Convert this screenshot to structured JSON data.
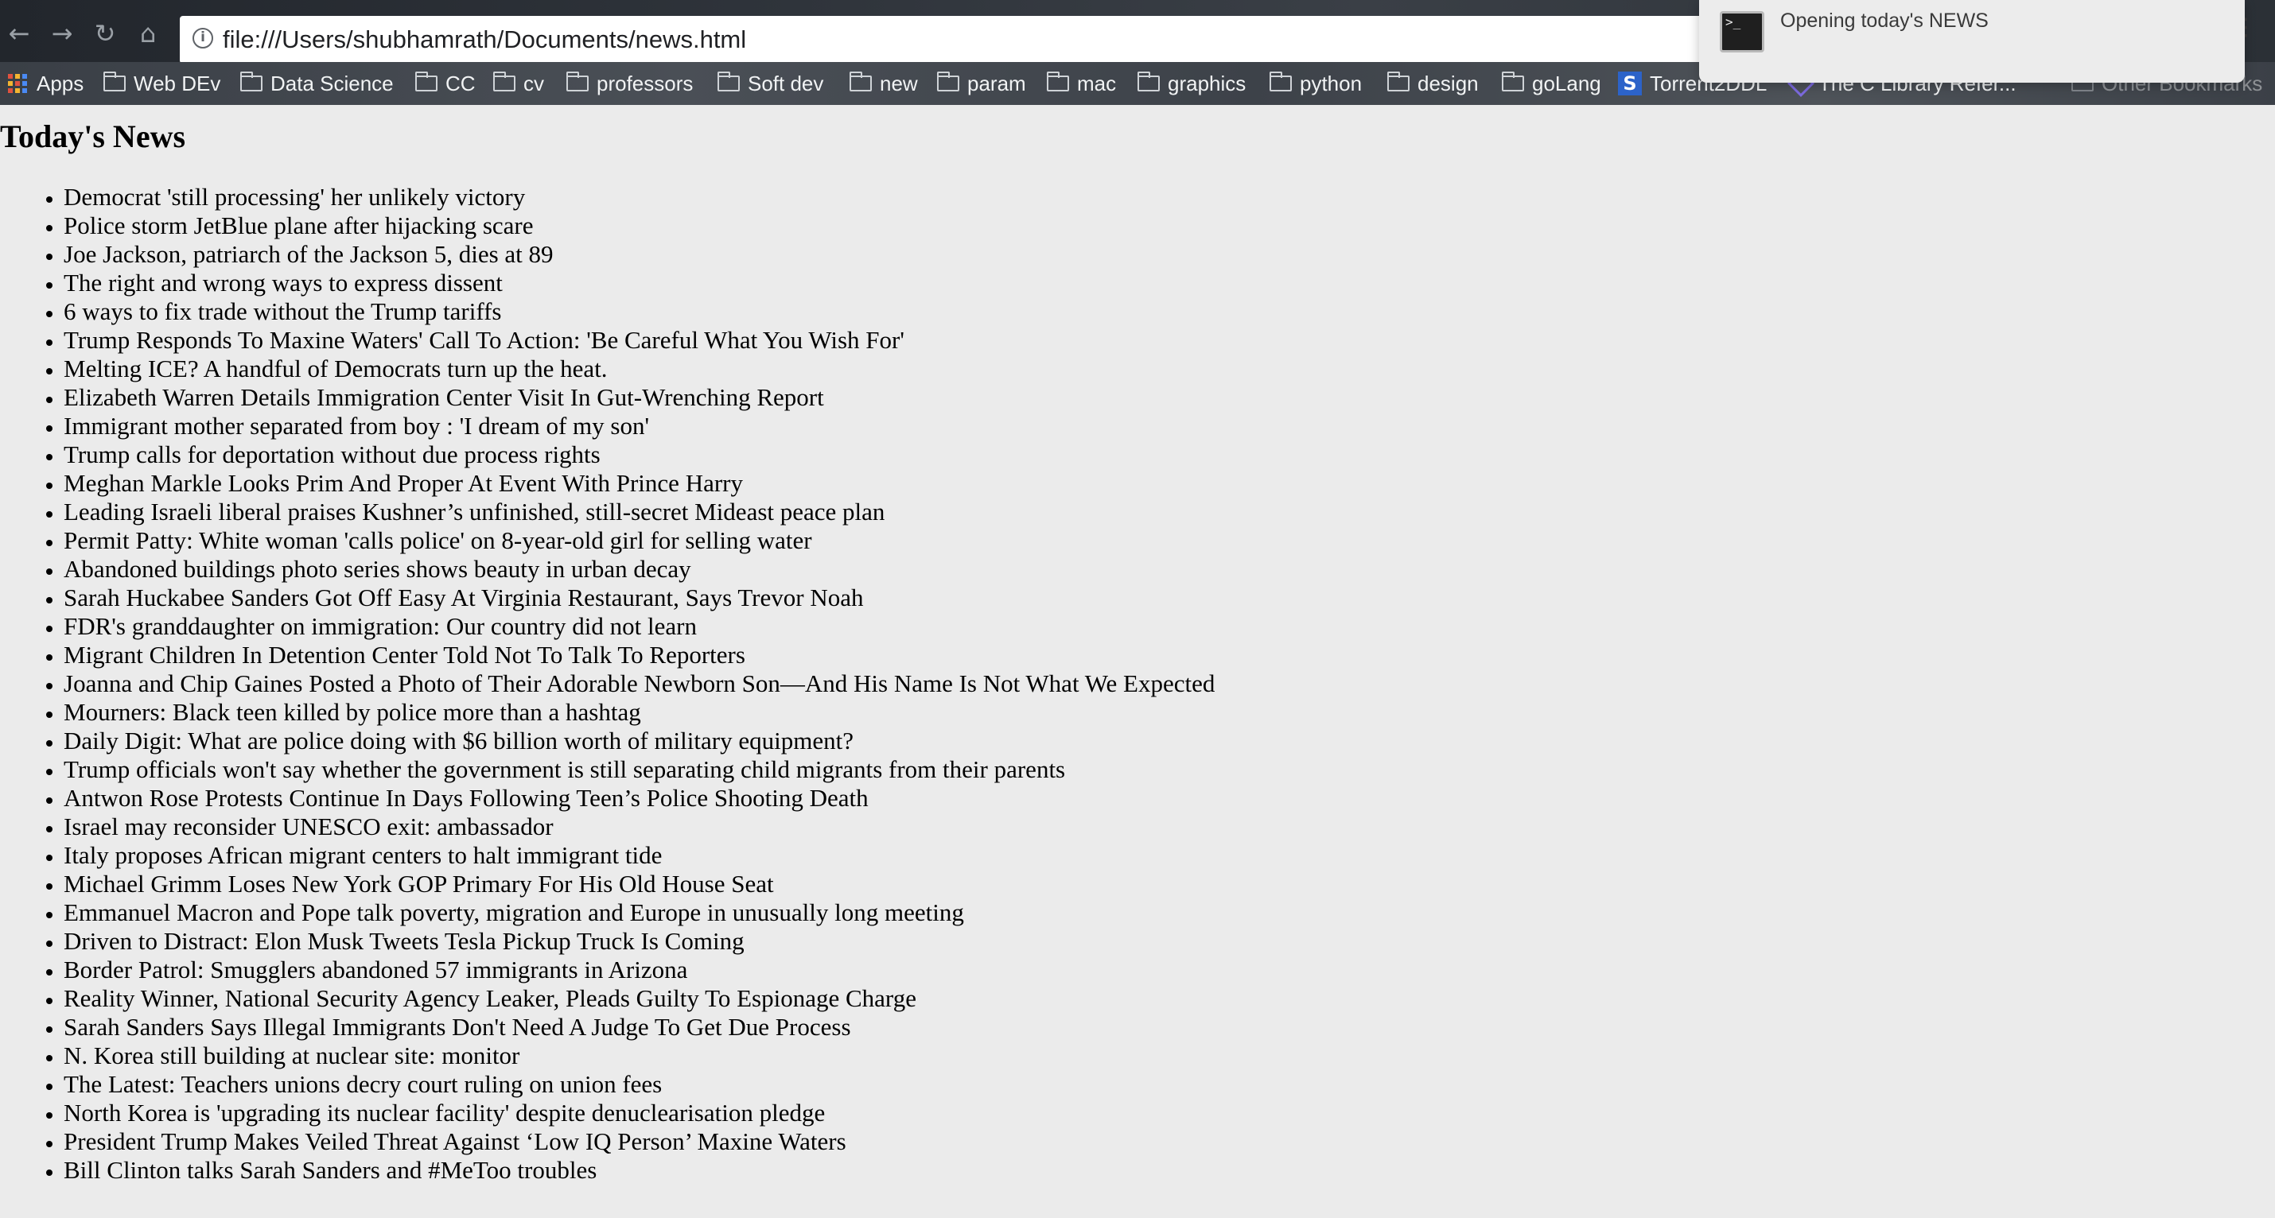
{
  "browser": {
    "url": "file:///Users/shubhamrath/Documents/news.html",
    "nav": {
      "back_glyph": "←",
      "forward_glyph": "→",
      "reload_glyph": "↻",
      "home_glyph": "⌂"
    },
    "more_glyph": "⋮"
  },
  "bookmarks": [
    {
      "label": "Apps",
      "icon": "apps-grid-icon"
    },
    {
      "label": "Web DEv",
      "icon": "folder-icon"
    },
    {
      "label": "Data Science",
      "icon": "folder-icon"
    },
    {
      "label": "CC",
      "icon": "folder-icon"
    },
    {
      "label": "cv",
      "icon": "folder-icon"
    },
    {
      "label": "professors",
      "icon": "folder-icon"
    },
    {
      "label": "Soft dev",
      "icon": "folder-icon"
    },
    {
      "label": "new",
      "icon": "folder-icon"
    },
    {
      "label": "param",
      "icon": "folder-icon"
    },
    {
      "label": "mac",
      "icon": "folder-icon"
    },
    {
      "label": "graphics",
      "icon": "folder-icon"
    },
    {
      "label": "python",
      "icon": "folder-icon"
    },
    {
      "label": "design",
      "icon": "folder-icon"
    },
    {
      "label": "goLang",
      "icon": "folder-icon"
    },
    {
      "label": "Torrent2DDL",
      "icon": "s-site-icon"
    },
    {
      "label": "The C Library Refer...",
      "icon": "diamond-site-icon"
    },
    {
      "label": "Other Bookmarks",
      "icon": "folder-icon"
    }
  ],
  "notification": {
    "title": "Opening today's NEWS",
    "icon_glyph": ">_"
  },
  "page": {
    "title": "Today's News",
    "headlines": [
      "Democrat 'still processing' her unlikely victory",
      "Police storm JetBlue plane after hijacking scare",
      "Joe Jackson, patriarch of the Jackson 5, dies at 89",
      "The right and wrong ways to express dissent",
      "6 ways to fix trade without the Trump tariffs",
      "Trump Responds To Maxine Waters' Call To Action: 'Be Careful What You Wish For'",
      "Melting ICE? A handful of Democrats turn up the heat.",
      "Elizabeth Warren Details Immigration Center Visit In Gut-Wrenching Report",
      "Immigrant mother separated from boy : 'I dream of my son'",
      "Trump calls for deportation without due process rights",
      "Meghan Markle Looks Prim And Proper At Event With Prince Harry",
      "Leading Israeli liberal praises Kushner’s unfinished, still-secret Mideast peace plan",
      "Permit Patty: White woman 'calls police' on 8-year-old girl for selling water",
      "Abandoned buildings photo series shows beauty in urban decay",
      "Sarah Huckabee Sanders Got Off Easy At Virginia Restaurant, Says Trevor Noah",
      "FDR's granddaughter on immigration: Our country did not learn",
      "Migrant Children In Detention Center Told Not To Talk To Reporters",
      "Joanna and Chip Gaines Posted a Photo of Their Adorable Newborn Son—And His Name Is Not What We Expected",
      "Mourners: Black teen killed by police more than a hashtag",
      "Daily Digit: What are police doing with $6 billion worth of military equipment?",
      "Trump officials won't say whether the government is still separating child migrants from their parents",
      "Antwon Rose Protests Continue In Days Following Teen’s Police Shooting Death",
      "Israel may reconsider UNESCO exit: ambassador",
      "Italy proposes African migrant centers to halt immigrant tide",
      "Michael Grimm Loses New York GOP Primary For His Old House Seat",
      "Emmanuel Macron and Pope talk poverty, migration and Europe in unusually long meeting",
      "Driven to Distract: Elon Musk Tweets Tesla Pickup Truck Is Coming",
      "Border Patrol: Smugglers abandoned 57 immigrants in Arizona",
      "Reality Winner, National Security Agency Leaker, Pleads Guilty To Espionage Charge",
      "Sarah Sanders Says Illegal Immigrants Don't Need A Judge To Get Due Process",
      "N. Korea still building at nuclear site: monitor",
      "The Latest: Teachers unions decry court ruling on union fees",
      "North Korea is 'upgrading its nuclear facility' despite denuclearisation pledge",
      "President Trump Makes Veiled Threat Against ‘Low IQ Person’ Maxine Waters",
      "Bill Clinton talks Sarah Sanders and #MeToo troubles"
    ]
  }
}
